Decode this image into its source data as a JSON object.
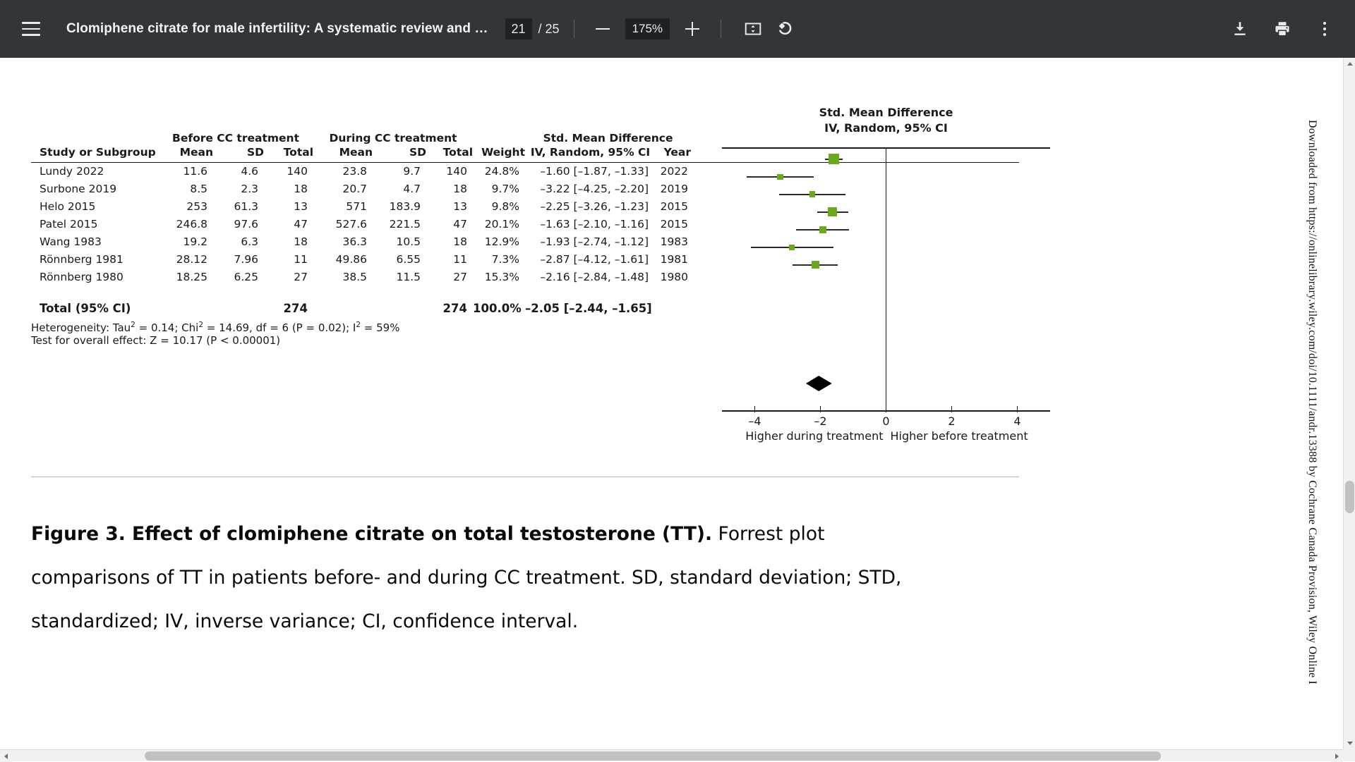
{
  "toolbar": {
    "menu_icon": "hamburger-menu-icon",
    "document_title": "Clomiphene citrate for male infertility: A systematic review and …",
    "current_page": "21",
    "page_count": "/ 25",
    "zoom_out_icon": "minus-icon",
    "zoom_level": "175%",
    "zoom_in_icon": "plus-icon",
    "fit_page_icon": "fit-to-page-icon",
    "rotate_icon": "rotate-counterclockwise-icon",
    "download_icon": "download-icon",
    "print_icon": "print-icon",
    "more_icon": "more-vertical-icon"
  },
  "watermark": {
    "text": "Downloaded from https://onlinelibrary.wiley.com/doi/10.1111/andr.13388 by Cochrane Canada Provision, Wiley Online Li"
  },
  "caption": {
    "bold_part": "Figure 3. Effect of clomiphene citrate on total testosterone (TT).",
    "rest": " Forrest plot comparisons of TT in patients before- and during CC treatment. SD, standard deviation; STD, standardized; IV, inverse variance; CI, confidence interval."
  },
  "chart_data": {
    "type": "forest",
    "title": "Std. Mean Difference",
    "subtitle": "IV, Random, 95% CI",
    "group_headers": {
      "before": "Before CC treatment",
      "during": "During CC treatment",
      "effect": "Std. Mean Difference",
      "effect_sub": "IV, Random, 95% CI"
    },
    "columns": [
      "Study or Subgroup",
      "Mean",
      "SD",
      "Total",
      "Mean",
      "SD",
      "Total",
      "Weight",
      "IV, Random, 95% CI",
      "Year"
    ],
    "rows": [
      {
        "study": "Lundy 2022",
        "b_mean": "11.6",
        "b_sd": "4.6",
        "b_total": "140",
        "d_mean": "23.8",
        "d_sd": "9.7",
        "d_total": "140",
        "weight": "24.8%",
        "smd_text": "–1.60 [–1.87, –1.33]",
        "year": "2022",
        "est": -1.6,
        "lo": -1.87,
        "hi": -1.33,
        "w": 24.8
      },
      {
        "study": "Surbone 2019",
        "b_mean": "8.5",
        "b_sd": "2.3",
        "b_total": "18",
        "d_mean": "20.7",
        "d_sd": "4.7",
        "d_total": "18",
        "weight": "9.7%",
        "smd_text": "–3.22 [–4.25, –2.20]",
        "year": "2019",
        "est": -3.22,
        "lo": -4.25,
        "hi": -2.2,
        "w": 9.7
      },
      {
        "study": "Helo 2015",
        "b_mean": "253",
        "b_sd": "61.3",
        "b_total": "13",
        "d_mean": "571",
        "d_sd": "183.9",
        "d_total": "13",
        "weight": "9.8%",
        "smd_text": "–2.25 [–3.26, –1.23]",
        "year": "2015",
        "est": -2.25,
        "lo": -3.26,
        "hi": -1.23,
        "w": 9.8
      },
      {
        "study": "Patel 2015",
        "b_mean": "246.8",
        "b_sd": "97.6",
        "b_total": "47",
        "d_mean": "527.6",
        "d_sd": "221.5",
        "d_total": "47",
        "weight": "20.1%",
        "smd_text": "–1.63 [–2.10, –1.16]",
        "year": "2015",
        "est": -1.63,
        "lo": -2.1,
        "hi": -1.16,
        "w": 20.1
      },
      {
        "study": "Wang 1983",
        "b_mean": "19.2",
        "b_sd": "6.3",
        "b_total": "18",
        "d_mean": "36.3",
        "d_sd": "10.5",
        "d_total": "18",
        "weight": "12.9%",
        "smd_text": "–1.93 [–2.74, –1.12]",
        "year": "1983",
        "est": -1.93,
        "lo": -2.74,
        "hi": -1.12,
        "w": 12.9
      },
      {
        "study": "Rönnberg 1981",
        "b_mean": "28.12",
        "b_sd": "7.96",
        "b_total": "11",
        "d_mean": "49.86",
        "d_sd": "6.55",
        "d_total": "11",
        "weight": "7.3%",
        "smd_text": "–2.87 [–4.12, –1.61]",
        "year": "1981",
        "est": -2.87,
        "lo": -4.12,
        "hi": -1.61,
        "w": 7.3
      },
      {
        "study": "Rönnberg 1980",
        "b_mean": "18.25",
        "b_sd": "6.25",
        "b_total": "27",
        "d_mean": "38.5",
        "d_sd": "11.5",
        "d_total": "27",
        "weight": "15.3%",
        "smd_text": "–2.16 [–2.84, –1.48]",
        "year": "1980",
        "est": -2.16,
        "lo": -2.84,
        "hi": -1.48,
        "w": 15.3
      }
    ],
    "total": {
      "label": "Total (95% CI)",
      "b_total": "274",
      "d_total": "274",
      "weight": "100.0%",
      "smd_text": "–2.05 [–2.44, –1.65]",
      "est": -2.05,
      "lo": -2.44,
      "hi": -1.65
    },
    "heterogeneity": "Heterogeneity: Tau² = 0.14; Chi² = 14.69, df = 6 (P = 0.02); I² = 59%",
    "overall_effect": "Test for overall effect: Z = 10.17 (P < 0.00001)",
    "axis": {
      "ticks": [
        "–4",
        "–2",
        "0",
        "2",
        "4"
      ],
      "tick_values": [
        -4,
        -2,
        0,
        2,
        4
      ],
      "xlim": [
        -5,
        5
      ],
      "left_caption": "Higher during treatment",
      "right_caption": "Higher before treatment"
    },
    "colors": {
      "marker": "#6aa91e",
      "line": "#2b2b2b",
      "diamond": "#000000"
    }
  }
}
